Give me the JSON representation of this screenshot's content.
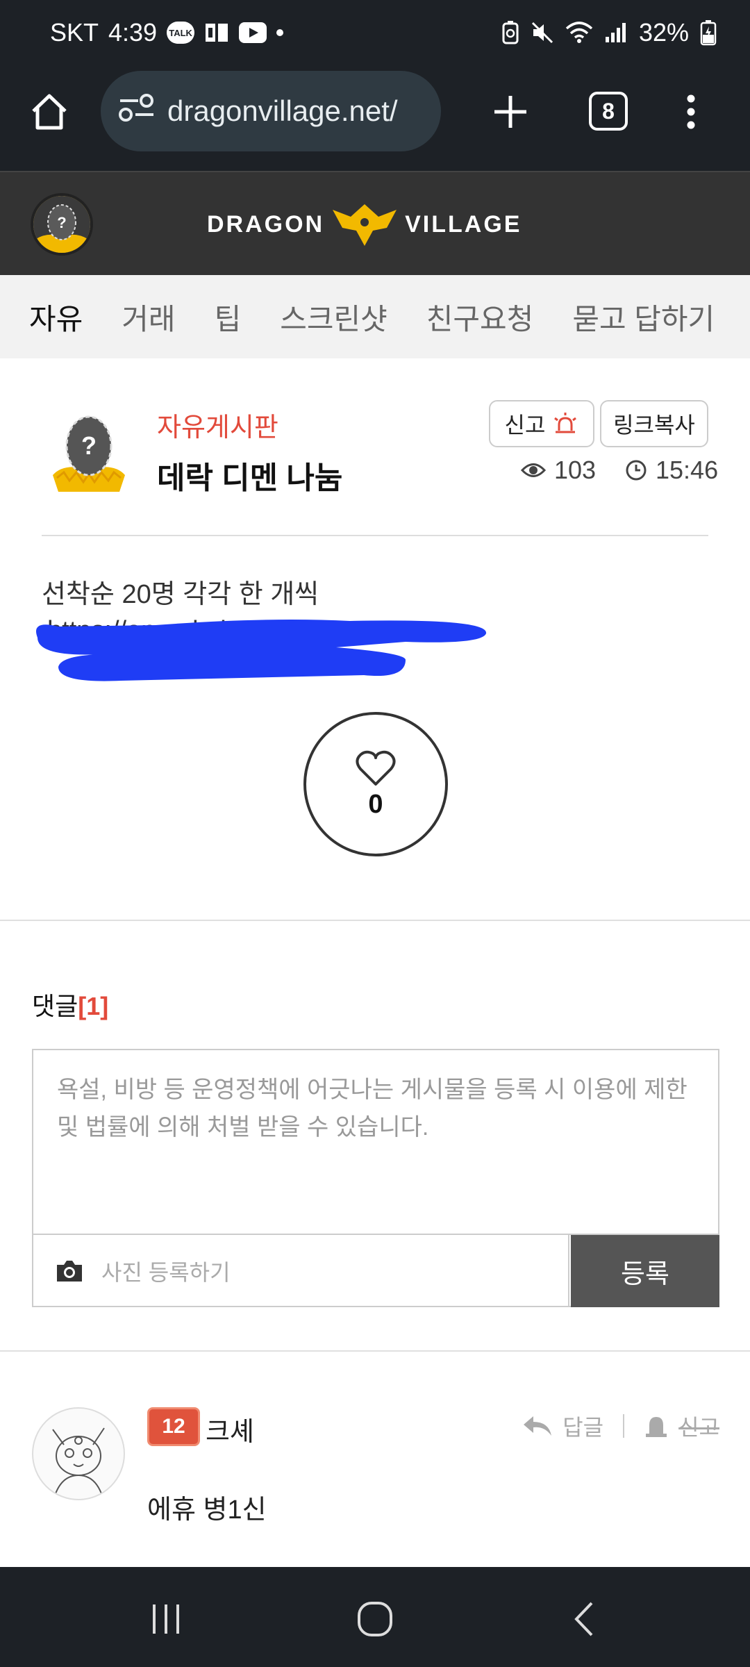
{
  "status_bar": {
    "carrier": "SKT",
    "time": "4:39",
    "talk_badge": "TALK",
    "battery": "32%"
  },
  "browser": {
    "url": "dragonvillage.net/",
    "tab_count": "8"
  },
  "site": {
    "logo_left": "DRAGON",
    "logo_right": "VILLAGE",
    "tabs": [
      "자유",
      "거래",
      "팁",
      "스크린샷",
      "친구요청",
      "묻고 답하기"
    ]
  },
  "post": {
    "board": "자유게시판",
    "title": "데락 디멘 나눔",
    "report_label": "신고",
    "copy_label": "링크복사",
    "views": "103",
    "time": "15:46",
    "body_line1": "선착순 20명 각각 한 개씩",
    "body_line2": "https://open.kak",
    "likes": "0"
  },
  "comments": {
    "heading": "댓글",
    "count": "[1]",
    "placeholder": "욕설, 비방 등 운영정책에 어긋나는 게시물을 등록 시 이용에 제한 및 법률에 의해 처벌 받을 수 있습니다.",
    "photo_label": "사진 등록하기",
    "submit_label": "등록",
    "items": [
      {
        "level": "12",
        "author": "크셰",
        "text": "에휴 병1신",
        "reply_label": "답글",
        "report_label": "신고"
      }
    ]
  },
  "colors": {
    "accent_red": "#e24a3b",
    "tab_highlight": "#ffd100",
    "header_bg": "#333333",
    "redaction_blue": "#1f3df5"
  }
}
